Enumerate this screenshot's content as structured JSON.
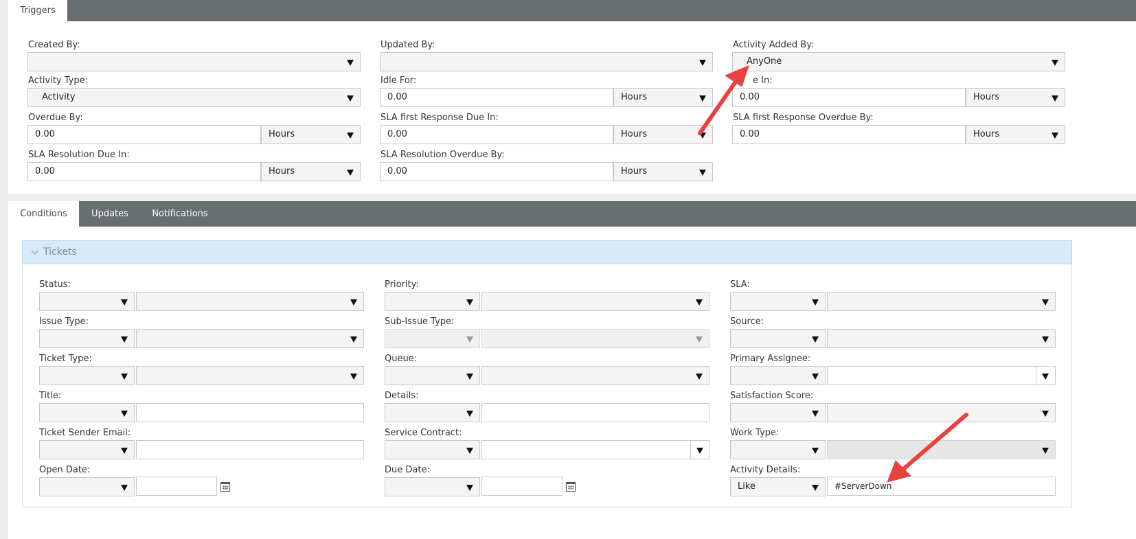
{
  "top_tabs": {
    "triggers": "Triggers"
  },
  "triggers": {
    "created_by": {
      "label": "Created By:",
      "value": ""
    },
    "updated_by": {
      "label": "Updated By:",
      "value": ""
    },
    "activity_added_by": {
      "label": "Activity Added By:",
      "value": "AnyOne"
    },
    "activity_type": {
      "label": "Activity Type:",
      "value": "Activity"
    },
    "idle_for": {
      "label": "Idle For:",
      "value": "0.00",
      "unit": "Hours"
    },
    "due_in": {
      "label": "e In:",
      "value": "0.00",
      "unit": "Hours"
    },
    "overdue_by": {
      "label": "Overdue By:",
      "value": "0.00",
      "unit": "Hours"
    },
    "sla_first_response_due_in": {
      "label": "SLA first Response Due In:",
      "value": "0.00",
      "unit": "Hours"
    },
    "sla_first_response_overdue_by": {
      "label": "SLA first Response Overdue By:",
      "value": "0.00",
      "unit": "Hours"
    },
    "sla_resolution_due_in": {
      "label": "SLA Resolution Due In:",
      "value": "0.00",
      "unit": "Hours"
    },
    "sla_resolution_overdue_by": {
      "label": "SLA Resolution Overdue By:",
      "value": "0.00",
      "unit": "Hours"
    }
  },
  "lower_tabs": {
    "conditions": "Conditions",
    "updates": "Updates",
    "notifications": "Notifications"
  },
  "tickets": {
    "header": "Tickets",
    "status": "Status:",
    "priority": "Priority:",
    "sla": "SLA:",
    "issue_type": "Issue Type:",
    "sub_issue_type": "Sub-Issue Type:",
    "source": "Source:",
    "ticket_type": "Ticket Type:",
    "queue": "Queue:",
    "primary_assignee": "Primary Assignee:",
    "title": "Title:",
    "details": "Details:",
    "satisfaction_score": "Satisfaction Score:",
    "ticket_sender_email": "Ticket Sender Email:",
    "service_contract": "Service Contract:",
    "work_type": "Work Type:",
    "open_date": "Open Date:",
    "due_date": "Due Date:",
    "activity_details": {
      "label": "Activity Details:",
      "operator": "Like",
      "value": "#ServerDown"
    }
  },
  "colors": {
    "tab_bar": "#676e70",
    "section_header": "#d8e9f7",
    "annotation_arrow": "#e8423f"
  },
  "icons": [
    "dropdown-arrow-icon",
    "calendar-icon",
    "chevron-down-icon",
    "annotation-arrow"
  ]
}
